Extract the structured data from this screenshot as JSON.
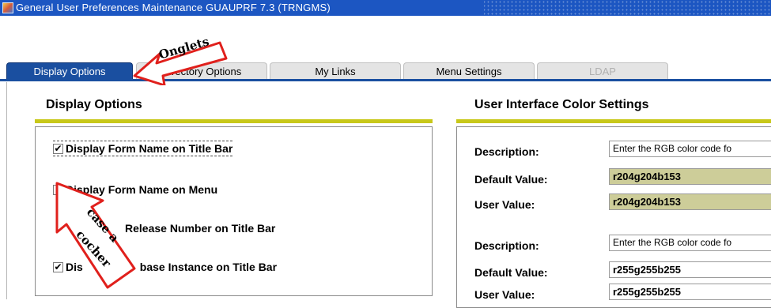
{
  "window": {
    "title": "General User Preferences Maintenance  GUAUPRF  7.3  (TRNGMS)"
  },
  "tabs": [
    {
      "label": "Display Options",
      "state": "active"
    },
    {
      "label": "Directory Options",
      "state": "normal"
    },
    {
      "label": "My Links",
      "state": "normal"
    },
    {
      "label": "Menu Settings",
      "state": "normal"
    },
    {
      "label": "LDAP",
      "state": "disabled"
    }
  ],
  "display_options": {
    "heading": "Display Options",
    "items": [
      {
        "label": "Display Form Name on Title Bar",
        "checked": true
      },
      {
        "label": "Display Form Name on Menu",
        "checked": false
      },
      {
        "label": "Release Number on Title Bar",
        "checked": false
      },
      {
        "label": "Dis",
        "label_end": "base Instance on Title Bar",
        "checked": true
      }
    ]
  },
  "color_settings": {
    "heading": "User Interface Color Settings",
    "groups": [
      {
        "description_label": "Description:",
        "description_value": "Enter the RGB color code fo",
        "default_label": "Default Value:",
        "default_value": "r204g204b153",
        "user_label": "User Value:",
        "user_value": "r204g204b153"
      },
      {
        "description_label": "Description:",
        "description_value": "Enter the RGB color code fo",
        "default_label": "Default Value:",
        "default_value": "r255g255b255",
        "user_label": "User Value:",
        "user_value": "r255g255b255"
      }
    ]
  },
  "annotations": {
    "tabs_callout": "Onglets",
    "checkbox_callout_line1": "case a",
    "checkbox_callout_line2": "cocher"
  },
  "colors": {
    "titlebar": "#1c56c2",
    "active_tab": "#1a4fa0",
    "section_rule": "#c8c81a",
    "readonly_field": "#cdcd99",
    "callout_arrow": "#e0201c"
  }
}
